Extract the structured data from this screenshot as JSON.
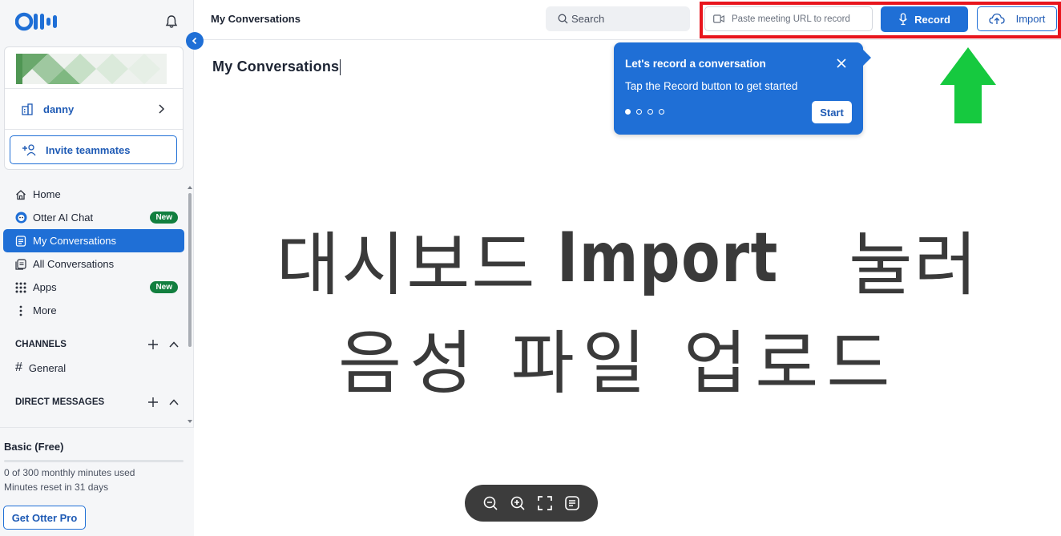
{
  "sidebar": {
    "workspace_name": "danny",
    "invite_label": "Invite teammates",
    "nav": [
      {
        "label": "Home",
        "icon": "home-icon"
      },
      {
        "label": "Otter AI Chat",
        "icon": "otter-chat-icon",
        "badge": "New"
      },
      {
        "label": "My Conversations",
        "icon": "conversations-icon",
        "active": true
      },
      {
        "label": "All Conversations",
        "icon": "all-conversations-icon"
      },
      {
        "label": "Apps",
        "icon": "apps-grid-icon",
        "badge": "New"
      },
      {
        "label": "More",
        "icon": "more-vertical-icon"
      }
    ],
    "channels_heading": "CHANNELS",
    "channel_general": "General",
    "dm_heading": "DIRECT MESSAGES"
  },
  "plan": {
    "title": "Basic (Free)",
    "usage": "0 of 300 monthly minutes used",
    "reset": "Minutes reset in 31 days",
    "usage_fraction": 0,
    "cta": "Get Otter Pro"
  },
  "topbar": {
    "title": "My Conversations",
    "search_label": "Search",
    "url_placeholder": "Paste meeting URL to record",
    "record_label": "Record",
    "import_label": "Import"
  },
  "main": {
    "heading": "My Conversations"
  },
  "tooltip": {
    "title": "Let's record a conversation",
    "body": "Tap the Record button to get started",
    "start_label": "Start",
    "steps_total": 4,
    "step_current": 1
  },
  "overlay": {
    "line1_before": "대시보드",
    "line1_bold": "Import",
    "line1_after": "눌러",
    "line2": "음성 파일 업로드"
  },
  "colors": {
    "accent": "#1f6fd6",
    "highlight": "#e8151d",
    "arrow": "#16c93f",
    "badge": "#127f3f"
  }
}
